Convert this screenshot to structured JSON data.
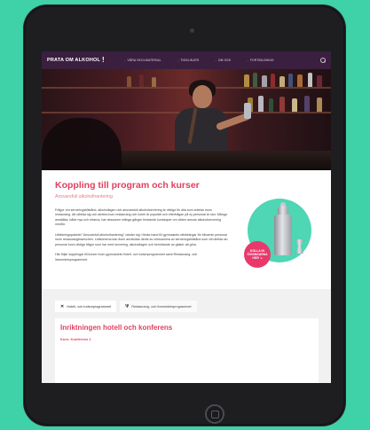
{
  "navbar": {
    "brand": "PRATA OM ALKOHOL",
    "brand_mark": "!",
    "items": [
      {
        "label": "VÅRA SKOLMATERIAL"
      },
      {
        "label": "TIDSLINJER"
      },
      {
        "label": "OM OSS"
      },
      {
        "label": "FORTBILDNING"
      }
    ]
  },
  "content": {
    "title": "Koppling till program och kurser",
    "subtitle": "Ansvarsfull alkoholhantering",
    "paragraphs": [
      "Frågor om serveringstillstånd, alkohollagen och ansvarsfull alkoholservering är viktiga för alla som arbetar inom restaurang. Att utbilda sig och arbeta inom restaurang och hotell är populärt och efterfrågan på ny personal är stor. Många anställda, både nya och erfarna, har dessutom många gånger bristande kunskaper om vikten ansvar alkoholservering medför.",
      "Utbildningspaketet \"Ansvarsfull alkoholhantering\" vänder sig i första hand till gymnasiets utbildningar för blivande personal inom restaurangbranschen. Lektionerna kan även användas direkt av verksamma av serveringstillstånd som vill utbilda sin personal inom viktiga frågor som har med servering, alkohollagen och bemötande av gäster att göra.",
      "Här följer kopplingar till kurser inom gymnasiets Hotell- och turismprogrammet samt Restaurang- och livsmedelsprogrammet."
    ]
  },
  "badge": {
    "lines": [
      "KOLLA IN",
      "ÖVNINGARNA",
      "HÄR ↘"
    ]
  },
  "tabs": [
    {
      "label": "Hotell- och turismprogrammet",
      "icon": "bed-icon"
    },
    {
      "label": "Restaurang- och livsmedelsprogrammet",
      "icon": "cutlery-icon"
    }
  ],
  "panel": {
    "title": "Inriktningen hotell och konferens",
    "subtitle": "Kurs: Konferens 1"
  },
  "colors": {
    "accent": "#e23f5e",
    "nav": "#3a1f3f",
    "background": "#3fd1a8",
    "badge": "#e8396a"
  }
}
